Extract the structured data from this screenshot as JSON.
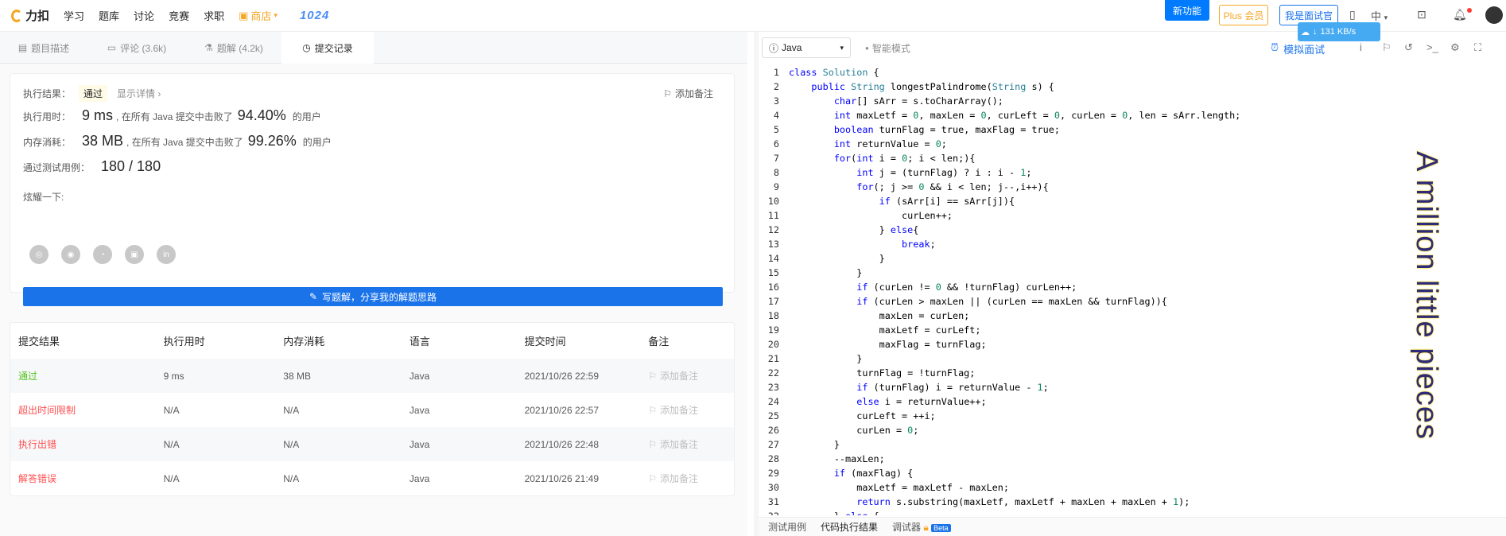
{
  "topnav": {
    "logo_text": "力扣",
    "items": [
      "学习",
      "题库",
      "讨论",
      "竞赛",
      "求职"
    ],
    "shop": "商店",
    "brand_1024": "1024",
    "new_feature": "新功能",
    "plus": "Plus 会员",
    "interviewer": "我是面试官",
    "lang": "中"
  },
  "tabs": [
    "题目描述",
    "评论 (3.6k)",
    "题解 (4.2k)",
    "提交记录"
  ],
  "result": {
    "status_label": "执行结果：",
    "status": "通过",
    "detail_link": "显示详情 ›",
    "add_note": "添加备注",
    "time_label": "执行用时：",
    "time_value": "9 ms",
    "time_text": ", 在所有 Java 提交中击败了",
    "time_pct": "94.40%",
    "users": "的用户",
    "mem_label": "内存消耗：",
    "mem_value": "38 MB",
    "mem_text": ", 在所有 Java 提交中击败了",
    "mem_pct": "99.26%",
    "cases_label": "通过测试用例：",
    "cases_value": "180 / 180",
    "share_label": "炫耀一下:",
    "write_button": "写题解，分享我的解题思路"
  },
  "table": {
    "headers": [
      "提交结果",
      "执行用时",
      "内存消耗",
      "语言",
      "提交时间",
      "备注"
    ],
    "rows": [
      {
        "result": "通过",
        "time": "9 ms",
        "mem": "38 MB",
        "lang": "Java",
        "date": "2021/10/26 22:59",
        "note": "添加备注",
        "color": "#52c41a"
      },
      {
        "result": "超出时间限制",
        "time": "N/A",
        "mem": "N/A",
        "lang": "Java",
        "date": "2021/10/26 22:57",
        "note": "添加备注",
        "color": "#ff4d4f"
      },
      {
        "result": "执行出错",
        "time": "N/A",
        "mem": "N/A",
        "lang": "Java",
        "date": "2021/10/26 22:48",
        "note": "添加备注",
        "color": "#ff4d4f"
      },
      {
        "result": "解答错误",
        "time": "N/A",
        "mem": "N/A",
        "lang": "Java",
        "date": "2021/10/26 21:49",
        "note": "添加备注",
        "color": "#ff4d4f"
      }
    ]
  },
  "editor": {
    "language": "Java",
    "smart_mode": "智能模式",
    "mock_interview": "模拟面试",
    "speed": "131 KB/s",
    "code_lines": [
      "class Solution {",
      "    public String longestPalindrome(String s) {",
      "        char[] sArr = s.toCharArray();",
      "        int maxLetf = 0, maxLen = 0, curLeft = 0, curLen = 0, len = sArr.length;",
      "        boolean turnFlag = true, maxFlag = true;",
      "        int returnValue = 0;",
      "        for(int i = 0; i < len;){",
      "            int j = (turnFlag) ? i : i - 1;",
      "            for(; j >= 0 && i < len; j--,i++){",
      "                if (sArr[i] == sArr[j]){",
      "                    curLen++;",
      "                } else{",
      "                    break;",
      "                }",
      "            }",
      "            if (curLen != 0 && !turnFlag) curLen++;",
      "            if (curLen > maxLen || (curLen == maxLen && turnFlag)){",
      "                maxLen = curLen;",
      "                maxLetf = curLeft;",
      "                maxFlag = turnFlag;",
      "            }",
      "            turnFlag = !turnFlag;",
      "            if (turnFlag) i = returnValue - 1;",
      "            else i = returnValue++;",
      "            curLeft = ++i;",
      "            curLen = 0;",
      "        }",
      "        --maxLen;",
      "        if (maxFlag) {",
      "            maxLetf = maxLetf - maxLen;",
      "            return s.substring(maxLetf, maxLetf + maxLen + maxLen + 1);",
      "        } else {"
    ],
    "watermark": "A million little pieces",
    "bottom_tabs": [
      "测试用例",
      "代码执行结果",
      "调试器"
    ],
    "beta": "Beta"
  }
}
